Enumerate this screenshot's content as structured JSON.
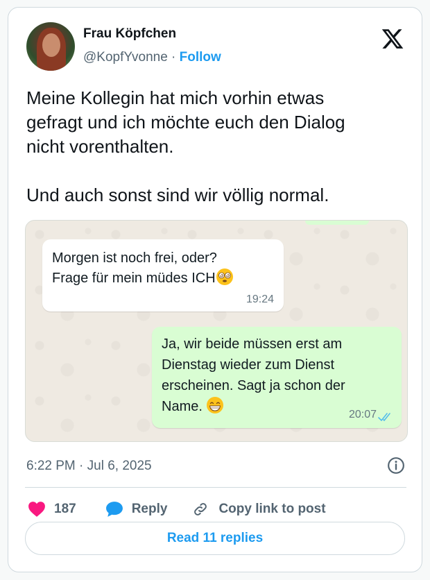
{
  "author": {
    "name": "Frau Köpfchen",
    "handle": "@KopfYvonne",
    "separator": " · ",
    "follow_label": "Follow"
  },
  "tweet": {
    "text": "Meine Kollegin hat mich vorhin etwas\ngefragt und ich möchte euch den Dialog\nnicht vorenthalten.\n\nUnd auch sonst sind wir völlig normal.",
    "timestamp": "6:22 PM · Jul 6, 2025"
  },
  "chat": {
    "incoming": {
      "text": "Morgen ist noch frei, oder?\nFrage für mein müdes ICH",
      "emoji": "dizzy-eyes-face",
      "time": "19:24"
    },
    "outgoing": {
      "text": "Ja, wir beide müssen erst am\nDienstag wieder zum Dienst\nerscheinen. Sagt ja schon der\nName. ",
      "emoji": "grinning-face",
      "time": "20:07",
      "status_icon": "double-check-read-icon"
    },
    "colors": {
      "incoming_bg": "#ffffff",
      "outgoing_bg": "#d9fdd3",
      "wallpaper": "#efeae2",
      "read_ticks": "#53bdeb"
    }
  },
  "actions": {
    "likes": "187",
    "reply_label": "Reply",
    "copy_label": "Copy link to post",
    "read_replies_label": "Read 11 replies"
  },
  "colors": {
    "accent": "#1d9bf0",
    "heart": "#f91880",
    "muted": "#536471"
  }
}
